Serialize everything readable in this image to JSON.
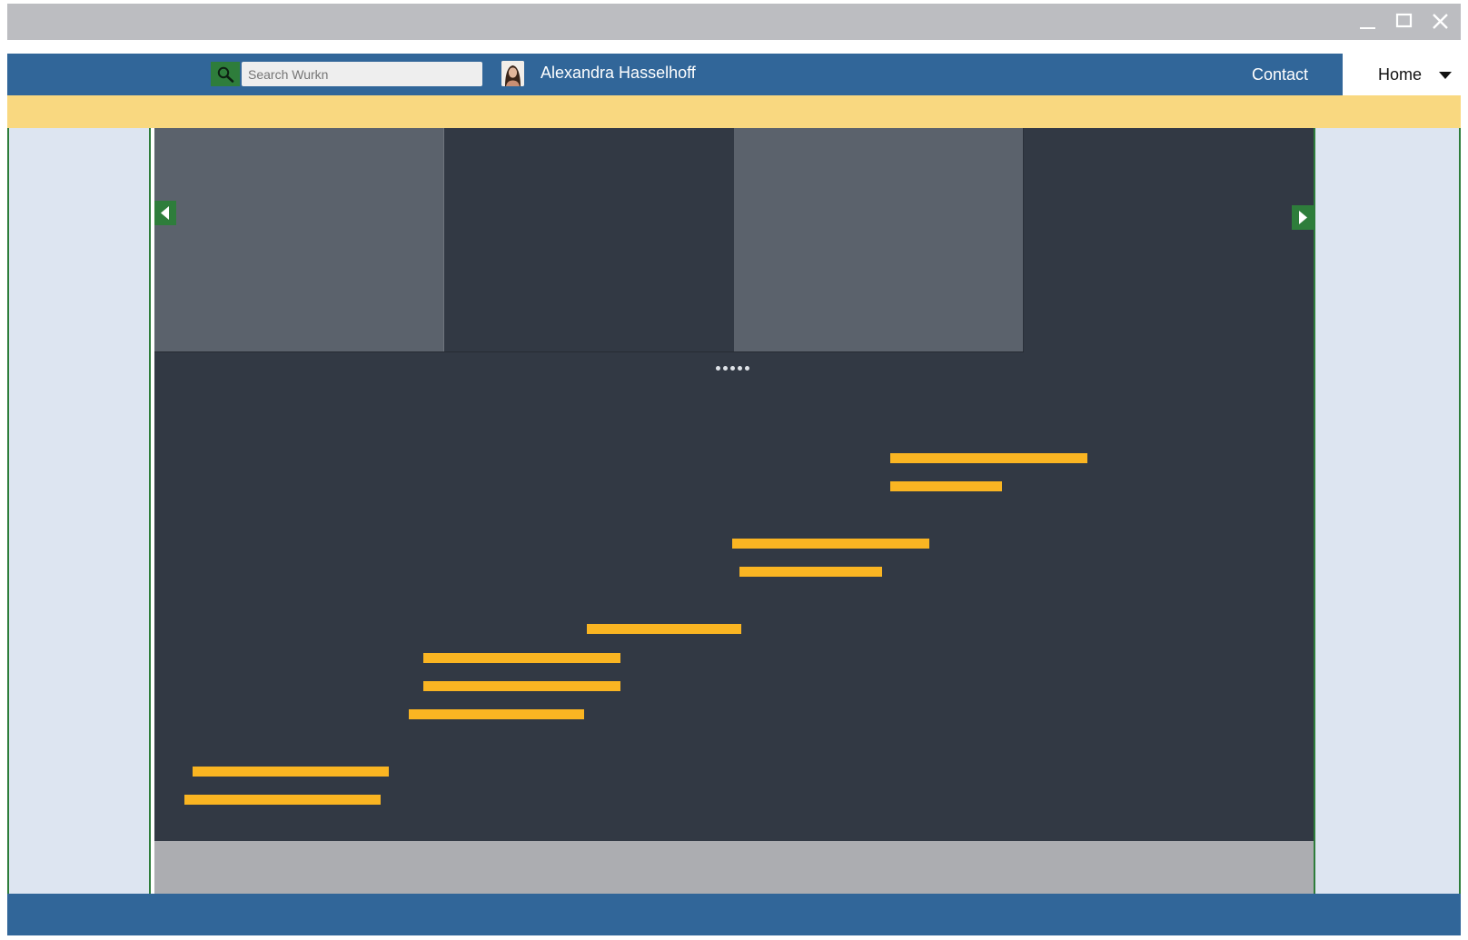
{
  "window": {
    "controls": {
      "minimize_icon": "minimize-icon",
      "maximize_icon": "maximize-icon",
      "close_icon": "close-icon"
    }
  },
  "navbar": {
    "search": {
      "placeholder": "Search Wurkn",
      "value": "",
      "icon": "search-icon"
    },
    "user": {
      "name": "Alexandra Hasselhoff",
      "avatar_icon": "avatar-icon"
    },
    "contact_label": "Contact",
    "home_label": "Home",
    "home_caret_icon": "chevron-down-icon"
  },
  "carousel": {
    "slide_count": 4,
    "dot_count": 5,
    "prev_icon": "chevron-left-icon",
    "next_icon": "chevron-right-icon"
  },
  "colors": {
    "navbar": "#316699",
    "accent_green": "#2e7d3b",
    "banner_yellow": "#f9d880",
    "bar_orange": "#fab522",
    "stage": "#323944",
    "side_panel": "#dde5f1"
  },
  "timeline_bars": [
    {
      "start": 0.0,
      "end": 0.1735,
      "row": 15
    },
    {
      "start": 0.0073,
      "end": 0.1808,
      "row": 14
    },
    {
      "start": 0.1986,
      "end": 0.3538,
      "row": 12
    },
    {
      "start": 0.2115,
      "end": 0.3862,
      "row": 11
    },
    {
      "start": 0.2115,
      "end": 0.3862,
      "row": 10
    },
    {
      "start": 0.3562,
      "end": 0.4935,
      "row": 9
    },
    {
      "start": 0.4919,
      "end": 0.618,
      "row": 7
    },
    {
      "start": 0.4854,
      "end": 0.6601,
      "row": 6
    },
    {
      "start": 0.6253,
      "end": 0.7244,
      "row": 4
    },
    {
      "start": 0.6253,
      "end": 0.8,
      "row": 3
    }
  ]
}
